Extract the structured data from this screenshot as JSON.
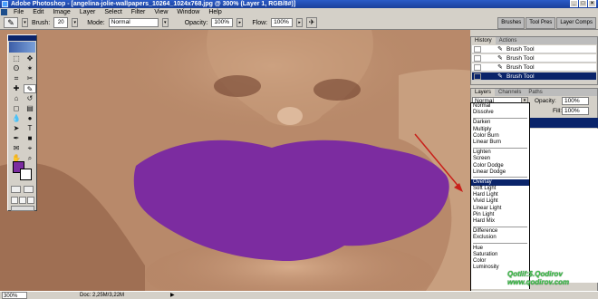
{
  "window": {
    "title": "Adobe Photoshop - [angelina-jolie-wallpapers_10264_1024x768.jpg @ 300% (Layer 1, RGB/8#)]",
    "controls": [
      "_",
      "□",
      "×"
    ]
  },
  "menu": [
    "File",
    "Edit",
    "Image",
    "Layer",
    "Select",
    "Filter",
    "View",
    "Window",
    "Help"
  ],
  "options_bar": {
    "brush_label": "Brush:",
    "brush_size": "20",
    "mode_label": "Mode:",
    "mode_value": "Normal",
    "opacity_label": "Opacity:",
    "opacity_value": "100%",
    "flow_label": "Flow:",
    "flow_value": "100%",
    "palette_well_tabs": [
      "Brushes",
      "Tool Pres",
      "Layer Comps"
    ]
  },
  "toolbox": {
    "tools": [
      "marquee-tool",
      "move-tool",
      "lasso-tool",
      "magic-wand-tool",
      "crop-tool",
      "slice-tool",
      "healing-tool",
      "brush-tool",
      "stamp-tool",
      "history-brush-tool",
      "eraser-tool",
      "gradient-tool",
      "blur-tool",
      "dodge-tool",
      "path-select-tool",
      "type-tool",
      "pen-tool",
      "shape-tool",
      "notes-tool",
      "eyedropper-tool",
      "hand-tool",
      "zoom-tool"
    ],
    "tool_glyphs": [
      "⬚",
      "✥",
      "ʘ",
      "✶",
      "⌗",
      "✂",
      "✚",
      "✎",
      "⌂",
      "↺",
      "◻",
      "▤",
      "💧",
      "●",
      "➤",
      "T",
      "✒",
      "■",
      "✉",
      "⌖",
      "✋",
      "⌕"
    ],
    "active_tool": "brush-tool",
    "foreground_color": "#7c2ca0",
    "background_color": "#ffffff"
  },
  "history_panel": {
    "tabs": [
      "History",
      "Actions"
    ],
    "items": [
      "Brush Tool",
      "Brush Tool",
      "Brush Tool",
      "Brush Tool"
    ],
    "selected_index": 3
  },
  "layers_panel": {
    "tabs": [
      "Layers",
      "Channels",
      "Paths"
    ],
    "blend_mode": "Normal",
    "opacity_label": "Opacity:",
    "opacity_value": "100%",
    "fill_label": "Fill:",
    "fill_value": "100%"
  },
  "blend_modes": {
    "groups": [
      [
        "Normal",
        "Dissolve"
      ],
      [
        "Darken",
        "Multiply",
        "Color Burn",
        "Linear Burn"
      ],
      [
        "Lighten",
        "Screen",
        "Color Dodge",
        "Linear Dodge"
      ],
      [
        "Overlay",
        "Soft Light",
        "Hard Light",
        "Vivid Light",
        "Linear Light",
        "Pin Light",
        "Hard Mix"
      ],
      [
        "Difference",
        "Exclusion"
      ],
      [
        "Hue",
        "Saturation",
        "Color",
        "Luminosity"
      ]
    ],
    "highlighted": "Overlay"
  },
  "watermark": {
    "line1": "Qotlif:$.Qodirov",
    "line2": "www.qodirov.com"
  },
  "status_bar": {
    "zoom": "300%",
    "doc": "Doc: 2,25M/3,22M",
    "arrow": "▶"
  },
  "colors": {
    "lip_paint": "#7c2ca0",
    "annotation_arrow": "#c8201a",
    "selection_blue": "#0a246a"
  }
}
